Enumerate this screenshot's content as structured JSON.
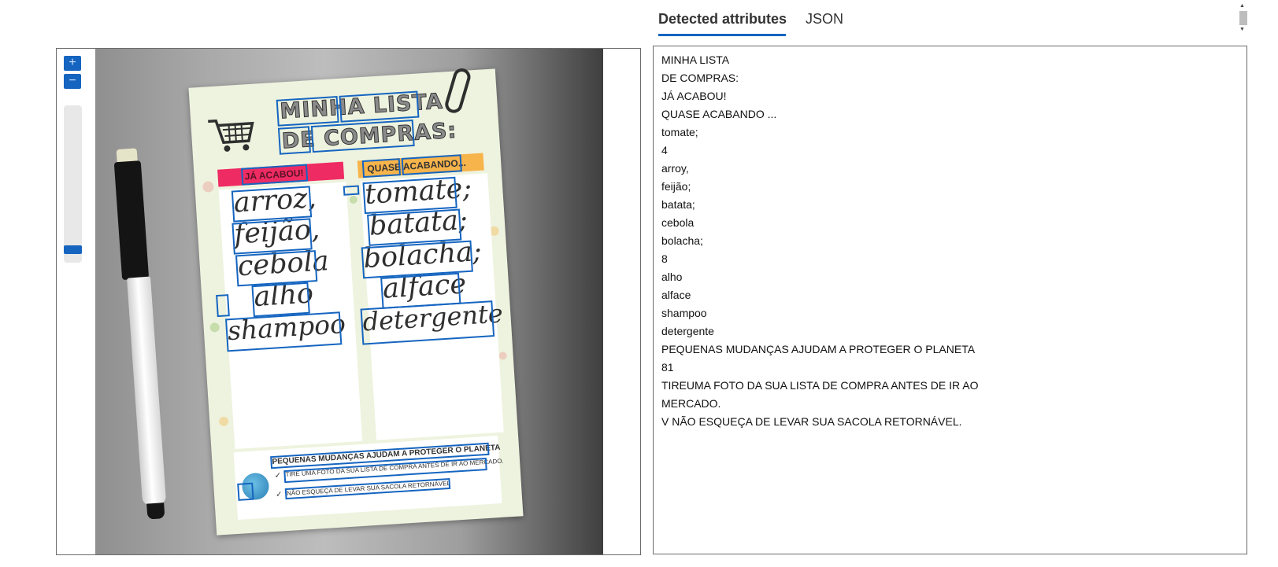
{
  "viewer": {
    "zoom_in_label": "+",
    "zoom_out_label": "−",
    "zoom_level": 0.1
  },
  "photo": {
    "title_line_1": "MINHA LISTA",
    "title_line_2": "DE COMPRAS:",
    "left_header": "JÁ ACABOU!",
    "right_header": "QUASE ACABANDO...",
    "left_items": [
      "arroz,",
      "feijão,",
      "cebola",
      "alho",
      "shampoo"
    ],
    "right_items": [
      "tomate;",
      "batata;",
      "bolacha;",
      "alface",
      "detergente"
    ],
    "footer_headline": "PEQUENAS MUDANÇAS AJUDAM A PROTEGER O PLANETA",
    "footer_tip_1": "TIRE UMA FOTO DA SUA LISTA DE COMPRA ANTES DE IR AO MERCADO.",
    "footer_tip_2": "NÃO ESQUEÇA DE LEVAR SUA SACOLA RETORNÁVEL",
    "check_mark": "✓"
  },
  "tabs": {
    "detected_label": "Detected attributes",
    "json_label": "JSON",
    "active": "Detected attributes"
  },
  "attributes": [
    "MINHA LISTA",
    "DE COMPRAS:",
    "JÁ ACABOU!",
    "QUASE ACABANDO ...",
    "tomate;",
    "4",
    "arroy,",
    "feijão;",
    "batata;",
    "cebola",
    "bolacha;",
    "8",
    "alho",
    "alface",
    "shampoo",
    "detergente",
    "PEQUENAS MUDANÇAS AJUDAM A PROTEGER O PLANETA",
    "81",
    "TIREUMA FOTO DA SUA LISTA DE COMPRA ANTES DE IR AO",
    "MERCADO.",
    "V NÃO ESQUEÇA DE LEVAR SUA SACOLA RETORNÁVEL."
  ],
  "colors": {
    "accent": "#1565c0",
    "left_header_bg": "#ef2b63",
    "right_header_bg": "#f7b44b"
  },
  "icons": {
    "zoom_in": "plus-icon",
    "zoom_out": "minus-icon",
    "cart": "shopping-cart-icon",
    "globe": "globe-icon",
    "clip": "paperclip-icon"
  }
}
